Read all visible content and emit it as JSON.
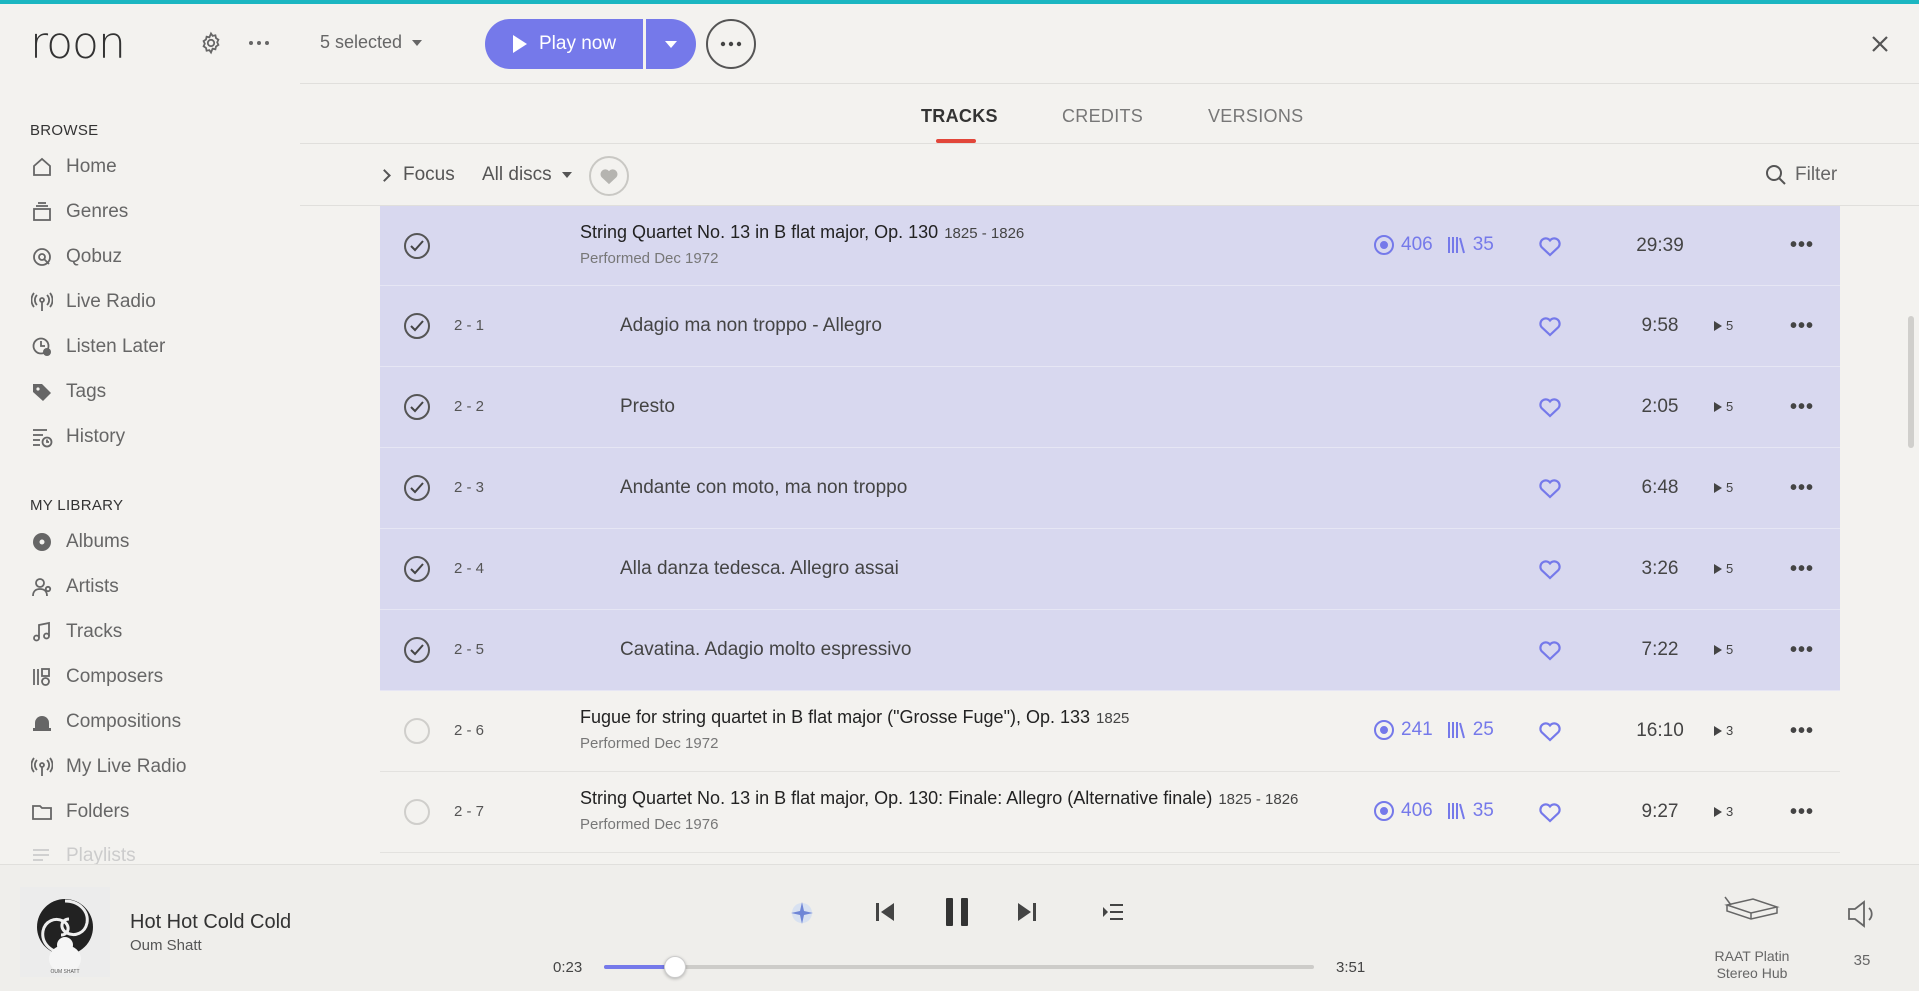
{
  "app": {
    "logo": "roon"
  },
  "header": {
    "selected_label": "5 selected",
    "play_now_label": "Play now",
    "more_label": "•••"
  },
  "sidebar": {
    "browse_heading": "BROWSE",
    "browse_items": [
      {
        "label": "Home",
        "icon": "home-icon"
      },
      {
        "label": "Genres",
        "icon": "genres-icon"
      },
      {
        "label": "Qobuz",
        "icon": "qobuz-icon"
      },
      {
        "label": "Live Radio",
        "icon": "radio-icon"
      },
      {
        "label": "Listen Later",
        "icon": "listen-later-icon"
      },
      {
        "label": "Tags",
        "icon": "tag-icon"
      },
      {
        "label": "History",
        "icon": "history-icon"
      }
    ],
    "library_heading": "MY LIBRARY",
    "library_items": [
      {
        "label": "Albums",
        "icon": "album-icon"
      },
      {
        "label": "Artists",
        "icon": "artist-icon"
      },
      {
        "label": "Tracks",
        "icon": "music-note-icon"
      },
      {
        "label": "Composers",
        "icon": "composer-icon"
      },
      {
        "label": "Compositions",
        "icon": "composition-icon"
      },
      {
        "label": "My Live Radio",
        "icon": "radio-icon"
      },
      {
        "label": "Folders",
        "icon": "folder-icon"
      },
      {
        "label": "Playlists",
        "icon": "playlist-icon"
      }
    ]
  },
  "tabs": [
    {
      "label": "TRACKS",
      "active": true
    },
    {
      "label": "CREDITS",
      "active": false
    },
    {
      "label": "VERSIONS",
      "active": false
    }
  ],
  "toolbar": {
    "focus_label": "Focus",
    "discs_label": "All discs",
    "filter_label": "Filter"
  },
  "tracks": [
    {
      "type": "work",
      "selected": true,
      "number": "",
      "title": "String Quartet No. 13 in B flat major, Op. 130",
      "years": "1825 - 1826",
      "performed": "Performed Dec 1972",
      "listeners": "406",
      "versions": "35",
      "duration": "29:39",
      "plays": ""
    },
    {
      "type": "track",
      "selected": true,
      "number": "2 - 1",
      "title": "Adagio ma non troppo - Allegro",
      "duration": "9:58",
      "plays": "5"
    },
    {
      "type": "track",
      "selected": true,
      "number": "2 - 2",
      "title": "Presto",
      "duration": "2:05",
      "plays": "5"
    },
    {
      "type": "track",
      "selected": true,
      "number": "2 - 3",
      "title": "Andante con moto, ma non troppo",
      "duration": "6:48",
      "plays": "5"
    },
    {
      "type": "track",
      "selected": true,
      "number": "2 - 4",
      "title": "Alla danza tedesca. Allegro assai",
      "duration": "3:26",
      "plays": "5"
    },
    {
      "type": "track",
      "selected": true,
      "number": "2 - 5",
      "title": "Cavatina. Adagio molto espressivo",
      "duration": "7:22",
      "plays": "5"
    },
    {
      "type": "work",
      "selected": false,
      "number": "2 - 6",
      "title": "Fugue for string quartet in B flat major (\"Grosse Fuge\"), Op. 133",
      "years": "1825",
      "performed": "Performed Dec 1972",
      "listeners": "241",
      "versions": "25",
      "duration": "16:10",
      "plays": "3"
    },
    {
      "type": "work",
      "selected": false,
      "number": "2 - 7",
      "title": "String Quartet No. 13 in B flat major, Op. 130: Finale: Allegro (Alternative finale)",
      "years": "1825 - 1826",
      "performed": "Performed Dec 1976",
      "listeners": "406",
      "versions": "35",
      "duration": "9:27",
      "plays": "3"
    }
  ],
  "now_playing": {
    "title": "Hot Hot Cold Cold",
    "artist": "Oum Shatt",
    "elapsed": "0:23",
    "total": "3:51",
    "progress_fraction": 0.0996,
    "album_art_caption": "OUM SHATT"
  },
  "zone": {
    "name_line1": "RAAT Platin",
    "name_line2": "Stereo Hub"
  },
  "volume": {
    "value": "35"
  },
  "colors": {
    "accent": "#7579ea",
    "selection": "#d8d8ef",
    "tab_underline": "#e2463a",
    "top_line": "#1bb6c1"
  }
}
